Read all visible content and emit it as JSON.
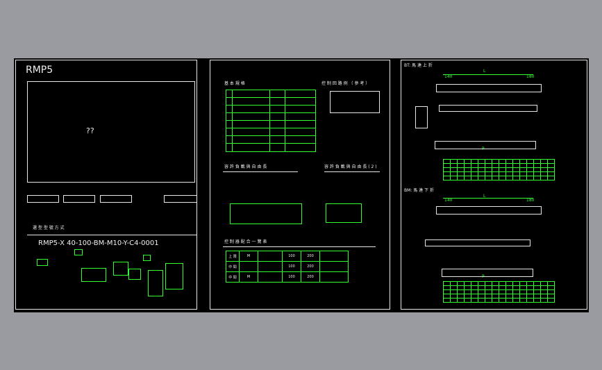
{
  "panel1": {
    "title": "RMP5",
    "placeholder_text": "??",
    "section_title": "選 型 型 號 方 式",
    "model_code": "RMP5-X 40-100-BM-M10-Y-C4-0001"
  },
  "panel2": {
    "section1_title": "基 本 規 格",
    "section2_title": "控 制 回 路 例 （ 參 考 ）",
    "section3_title": "容 許 負 載 與 自 由 長",
    "section4_title": "容 許 負 載 與 自 由 長 ( 2 )",
    "section5_title": "控 制 器 配 合 一 覽 表",
    "table_headers": [
      "",
      "",
      "",
      "",
      "",
      ""
    ],
    "table_rows": [
      [
        "上 限",
        "M",
        "",
        "100",
        "200",
        ""
      ],
      [
        "中 間",
        "",
        "",
        "100",
        "200",
        ""
      ],
      [
        "中 間",
        "M",
        "",
        "100",
        "200",
        ""
      ]
    ]
  },
  "panel3": {
    "section1_title": "BT: 馬 達 上 折",
    "section2_title": "BM: 馬 達 下 折",
    "dim_L": "L",
    "dim_left": "140",
    "dim_right": "180",
    "dim_P": "P"
  }
}
